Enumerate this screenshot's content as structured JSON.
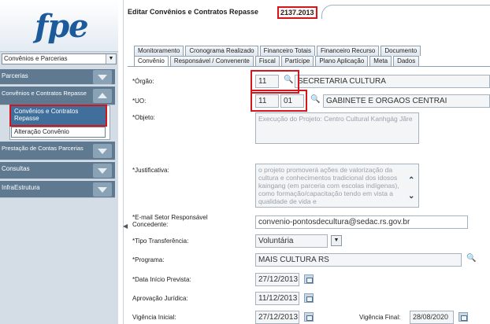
{
  "logo": "fpe",
  "sidebar": {
    "module_select": "Convênios e Parcerias",
    "items": [
      {
        "label": "Parcerias"
      },
      {
        "label": "Convênios e Contratos Repasse"
      },
      {
        "label": "Prestação de Contas Parcerias"
      },
      {
        "label": "Consultas"
      },
      {
        "label": "InfraEstrutura"
      }
    ],
    "sub_items": [
      {
        "label": "Convênios e Contratos Repasse"
      },
      {
        "label": "Alteração Convênio"
      }
    ]
  },
  "header": {
    "title": "Editar Convênios e Contratos Repasse",
    "record_id": "2137.2013"
  },
  "tabs_row1": [
    "Monitoramento",
    "Cronograma Realizado",
    "Financeiro Totais",
    "Financeiro Recurso",
    "Documento"
  ],
  "tabs_row2": [
    "Convênio",
    "Responsável / Convenente",
    "Fiscal",
    "Partícipe",
    "Plano Aplicação",
    "Meta",
    "Dados"
  ],
  "form": {
    "orgao": {
      "label": "*Órgão:",
      "code": "11",
      "name": "SECRETARIA CULTURA"
    },
    "uo": {
      "label": "*UO:",
      "code1": "11",
      "code2": "01",
      "name": "GABINETE E ORGAOS CENTRAI"
    },
    "objeto": {
      "label": "*Objeto:",
      "text": "Execução do Projeto: Centro Cultural Kanhgág Jãre"
    },
    "justificativa": {
      "label": "*Justificativa:",
      "text": "o projeto promoverá ações de valorização da cultura e conhecimentos tradicional dos idosos kaingang (em parceria com escolas indígenas), como formação/capacitação tendo em vista a qualidade de vida e"
    },
    "email": {
      "label": "*E-mail Setor Responsável Concedente:",
      "value": "convenio-pontosdecultura@sedac.rs.gov.br"
    },
    "tipo": {
      "label": "*Tipo Transferência:",
      "value": "Voluntária"
    },
    "programa": {
      "label": "*Programa:",
      "value": "MAIS CULTURA RS"
    },
    "data_inicio": {
      "label": "*Data Início Prevista:",
      "value": "27/12/2013"
    },
    "aprovacao": {
      "label": "Aprovação Jurídica:",
      "value": "11/12/2013"
    },
    "vigencia_inicial": {
      "label": "Vigência Inicial:",
      "value": "27/12/2013"
    },
    "vigencia_final": {
      "label": "Vigência Final:",
      "value": "28/08/2020"
    }
  },
  "icons": {
    "search": "search-icon",
    "calendar": "calendar-icon",
    "chevron": "chevron-down-icon"
  },
  "colors": {
    "highlight": "#d4161c",
    "brand": "#1c5a9c",
    "sidebar_item": "#5f7a90"
  }
}
